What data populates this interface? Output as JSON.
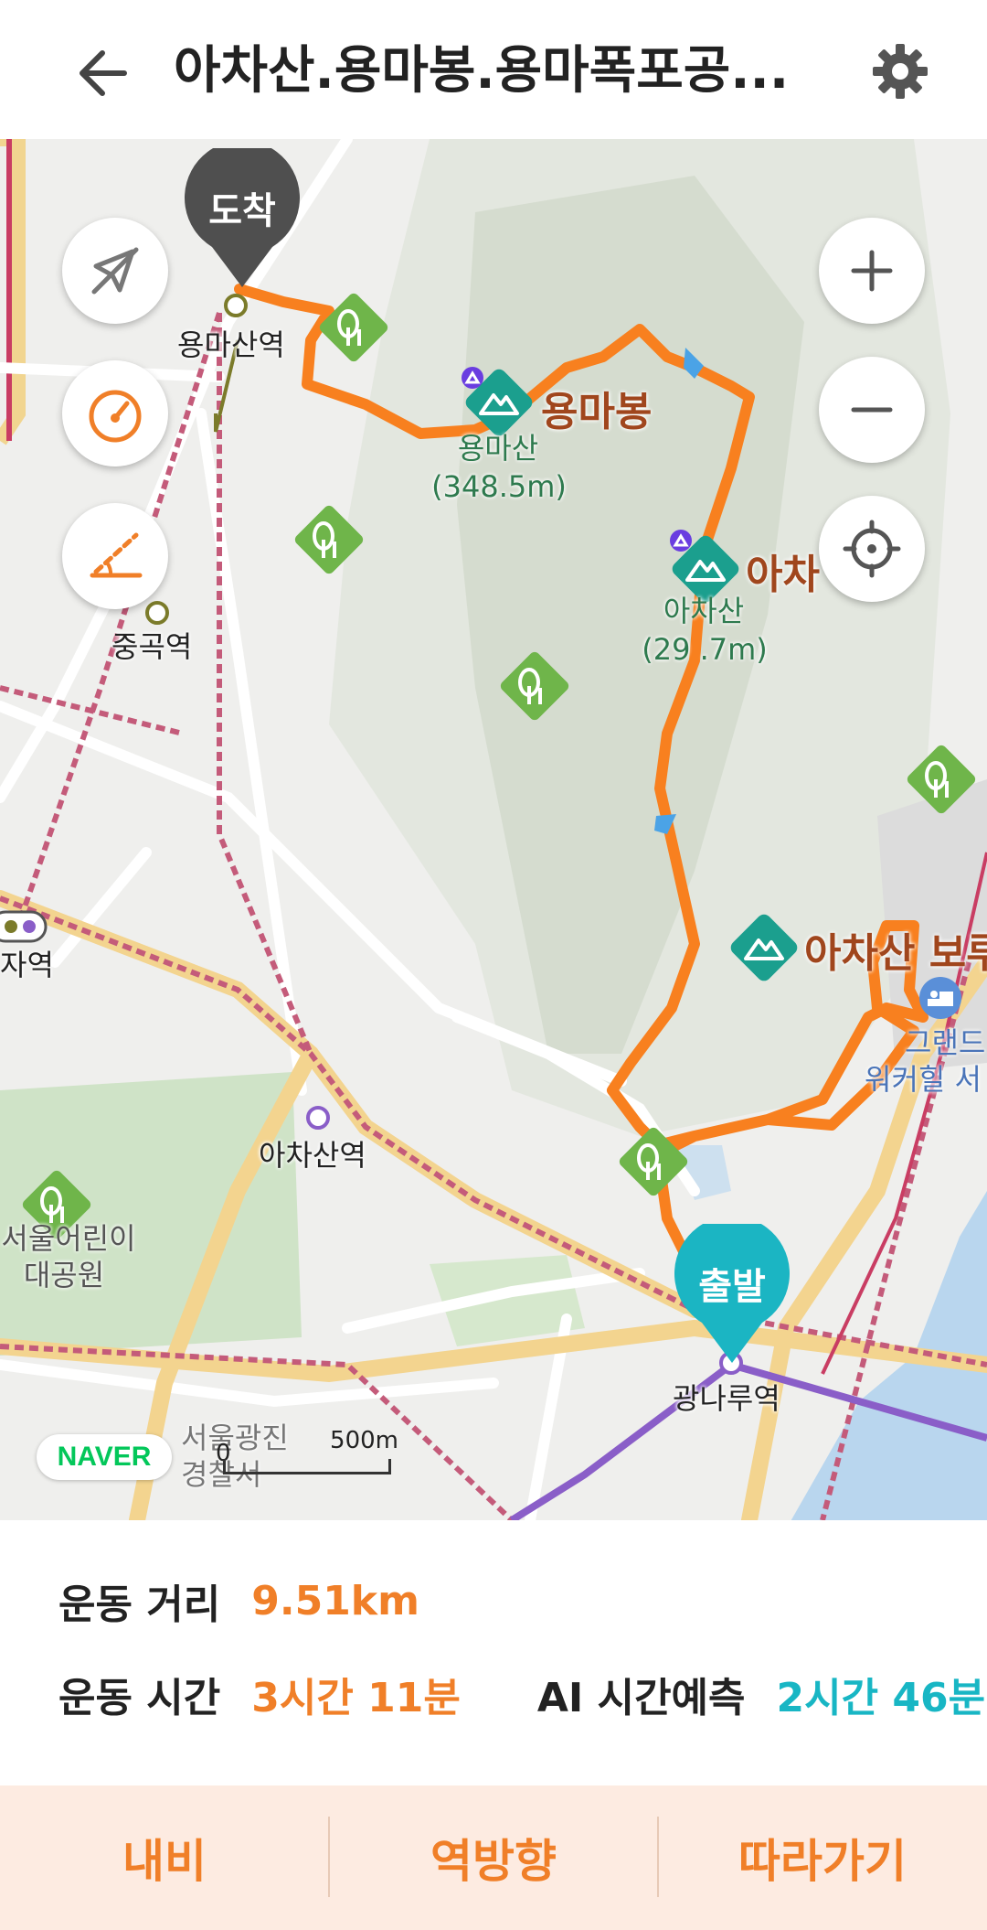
{
  "header": {
    "title": "아차산.용마봉.용마폭포공...",
    "back_icon": "arrow-left-icon",
    "settings_icon": "gear-icon"
  },
  "map": {
    "labels": {
      "arrival_marker": "도착",
      "start_marker": "출발",
      "station_yongmasan": "용마산역",
      "station_junggok": "중곡역",
      "station_achasan": "아차산역",
      "station_gwangnaru": "광나루역",
      "station_partial_left": "자역",
      "peak_yongmabong": "용마봉",
      "peak_yongmasan_name": "용마산",
      "peak_yongmasan_height": "(348.5m)",
      "peak_acha_partial": "아차",
      "peak_achasan_name": "아차산",
      "peak_achasan_height": "(29 .7m)",
      "poi_achasan_boru": "아차산 보루",
      "hotel_line1": "그랜드",
      "hotel_line2": "워커힐 서",
      "park_line1": "서울어린이",
      "park_line2": "대공원",
      "police_line1": "서울광진",
      "police_line2": "경찰서"
    },
    "brand": "NAVER",
    "scale": {
      "zero": "0",
      "distance": "500m"
    },
    "controls": {
      "compass": "compass-off-icon",
      "speed": "speedometer-icon",
      "slope": "slope-icon",
      "zoom_in": "plus-icon",
      "zoom_out": "minus-icon",
      "locate": "crosshair-icon"
    },
    "colors": {
      "route": "#f8801f",
      "start": "#1bb5c3",
      "arrival": "#4f4f4f"
    }
  },
  "stats": {
    "distance_label": "운동 거리",
    "distance_value": "9.51km",
    "time_label": "운동 시간",
    "time_value": "3시간 11분",
    "ai_label": "AI 시간예측",
    "ai_value": "2시간 46분"
  },
  "actions": {
    "navigate": "내비",
    "reverse": "역방향",
    "follow": "따라가기"
  }
}
